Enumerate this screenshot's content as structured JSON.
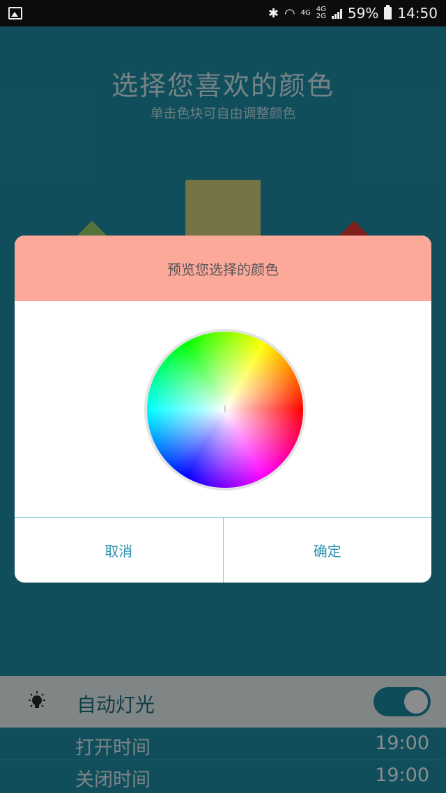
{
  "status_bar": {
    "gallery_icon": "gallery-icon",
    "bluetooth": "bluetooth-icon",
    "wifi": "wifi-icon",
    "net_4g": "4G",
    "net_4g_b": "4G",
    "net_2g": "2G",
    "battery_pct": "59%",
    "time": "14:50"
  },
  "main": {
    "title": "选择您喜欢的颜色",
    "subtitle": "单击色块可自由调整颜色",
    "swatch_colors": {
      "center": "#d8d27e",
      "left": "#9bd36d",
      "right": "#e63b2e"
    }
  },
  "settings": {
    "auto_light_label": "自动灯光",
    "auto_light_icon": "bulb-icon",
    "auto_light_on": true,
    "open_time_label": "打开时间",
    "open_time_value": "19:00",
    "close_time_label": "关闭时间",
    "close_time_value": "19:00"
  },
  "dialog": {
    "header": "预览您选择的颜色",
    "header_color": "#fda99a",
    "cancel_label": "取消",
    "confirm_label": "确定"
  }
}
